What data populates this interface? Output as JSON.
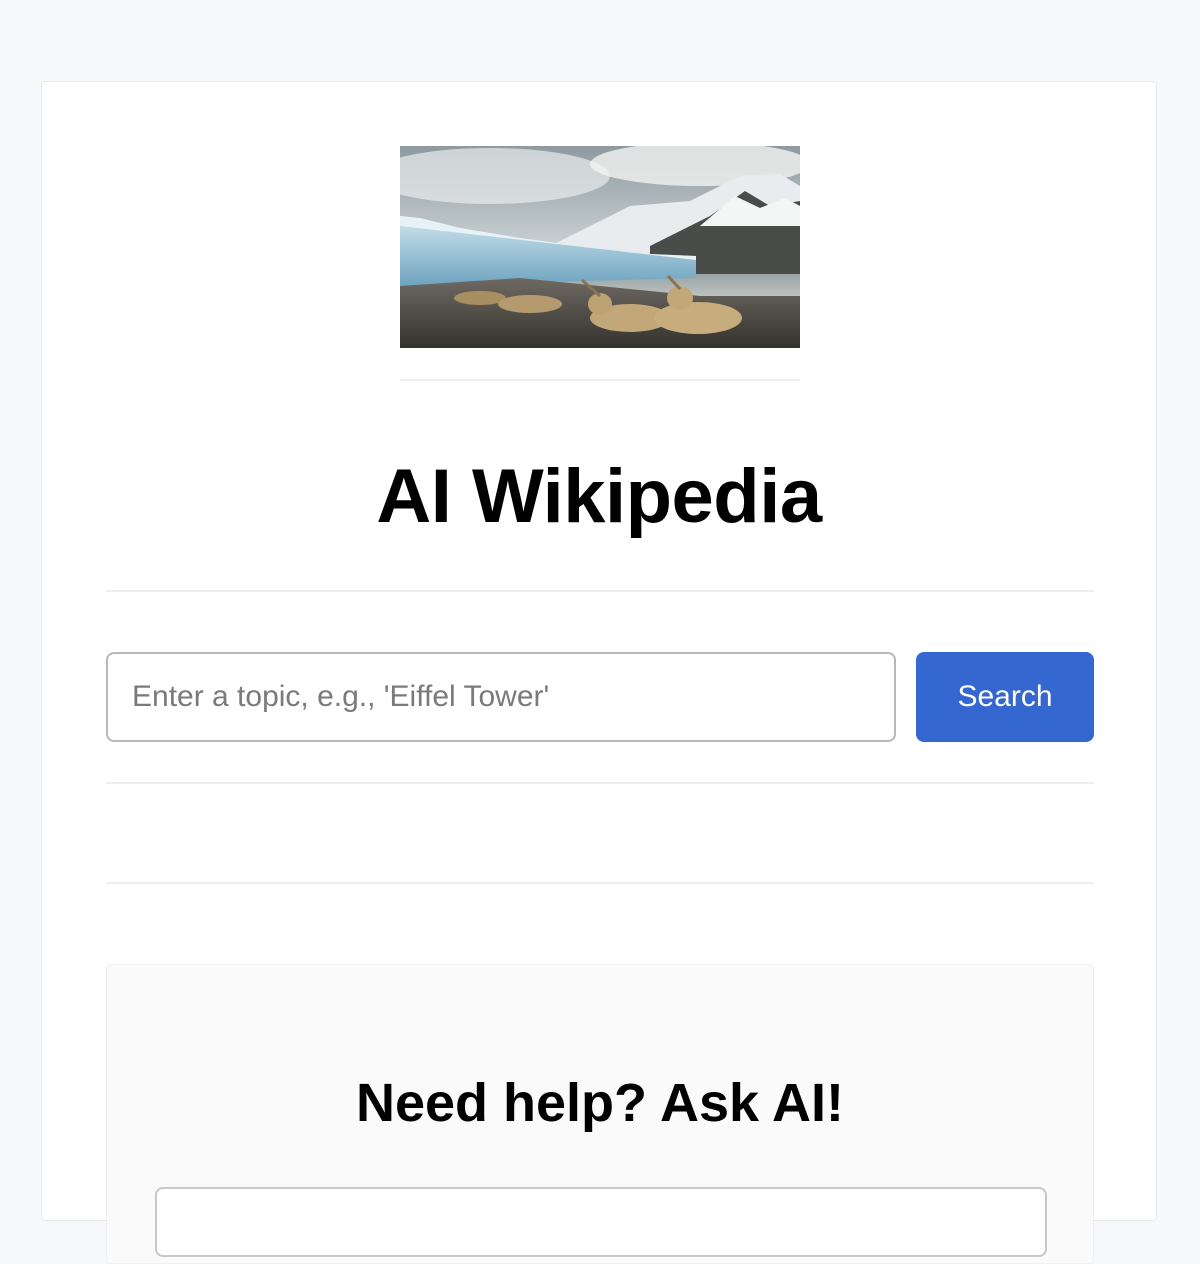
{
  "header": {
    "banner_image": "glacier-landscape-with-seals"
  },
  "page": {
    "title": "AI Wikipedia"
  },
  "search": {
    "placeholder": "Enter a topic, e.g., 'Eiffel Tower'",
    "value": "",
    "button_label": "Search"
  },
  "help": {
    "title": "Need help? Ask AI!"
  },
  "colors": {
    "page_background": "#f7f8fa",
    "card_background": "#ffffff",
    "accent": "#3467d0",
    "help_panel": "#fafafa"
  }
}
